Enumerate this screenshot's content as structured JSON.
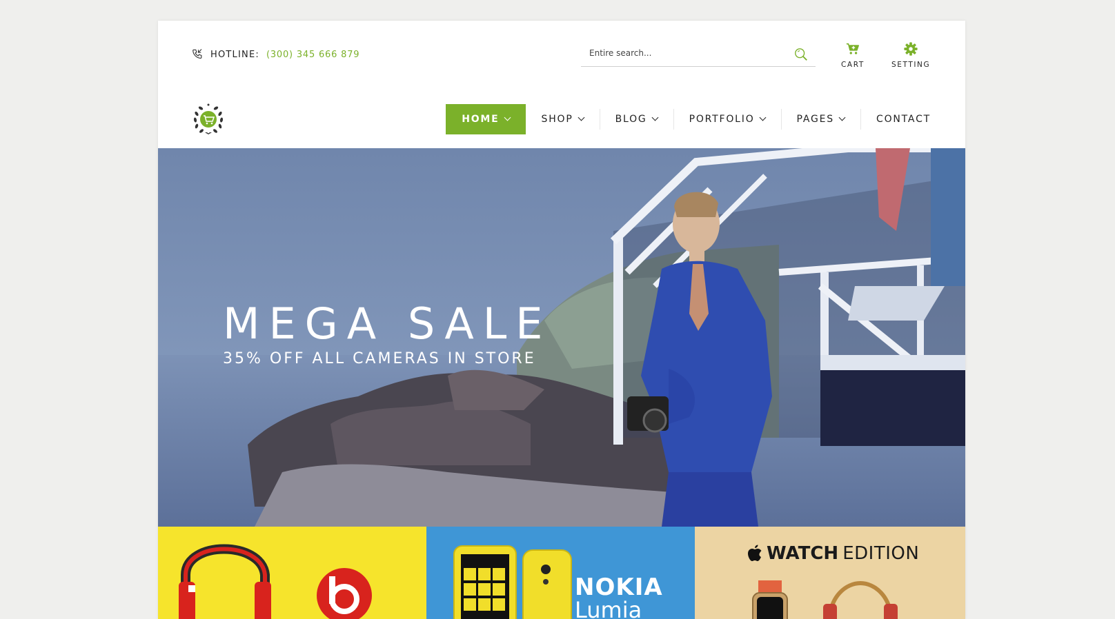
{
  "topbar": {
    "hotline_label": "HOTLINE:",
    "hotline_number": "(300) 345 666 879",
    "search_placeholder": "Entire search...",
    "cart_label": "CART",
    "setting_label": "SETTING"
  },
  "nav": {
    "items": [
      {
        "label": "HOME",
        "active": true,
        "dropdown": true
      },
      {
        "label": "SHOP",
        "dropdown": true
      },
      {
        "label": "BLOG",
        "dropdown": true
      },
      {
        "label": "PORTFOLIO",
        "dropdown": true
      },
      {
        "label": "PAGES",
        "dropdown": true
      },
      {
        "label": "CONTACT",
        "dropdown": false
      }
    ]
  },
  "hero": {
    "title": "MEGA SALE",
    "subtitle": "35% OFF ALL CAMERAS IN STORE"
  },
  "banners": {
    "nokia_brand": "NOKIA",
    "nokia_model": "Lumia",
    "watch_word": "WATCH",
    "watch_edition": "EDITION"
  },
  "colors": {
    "accent": "#7bb12a",
    "banner_yellow": "#f6e42c",
    "banner_blue": "#3f96d6",
    "banner_beige": "#ecd4a3"
  }
}
